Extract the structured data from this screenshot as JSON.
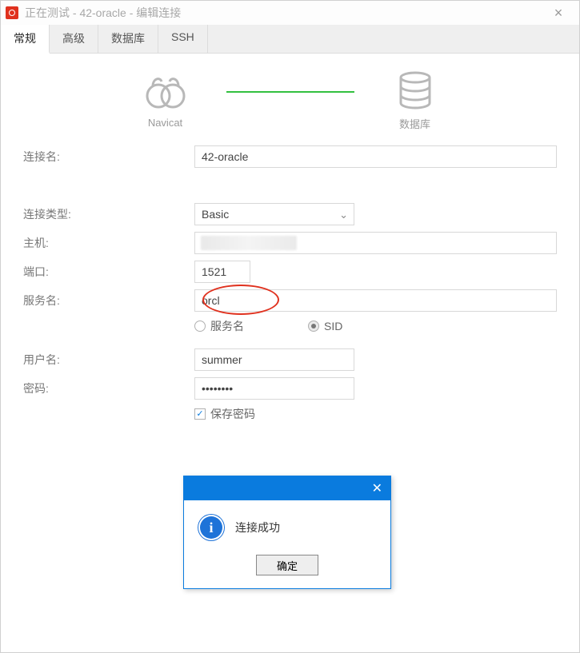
{
  "window_title": "正在测试 - 42-oracle - 编辑连接",
  "tabs": {
    "general": "常规",
    "advanced": "高级",
    "database": "数据库",
    "ssh": "SSH"
  },
  "diagram": {
    "left_label": "Navicat",
    "right_label": "数据库"
  },
  "labels": {
    "conn_name": "连接名:",
    "conn_type": "连接类型:",
    "host": "主机:",
    "port": "端口:",
    "service_name": "服务名:",
    "user": "用户名:",
    "password": "密码:"
  },
  "values": {
    "conn_name": "42-oracle",
    "conn_type": "Basic",
    "host": "",
    "port": "1521",
    "service_name": "orcl",
    "user": "summer",
    "password": "••••••••"
  },
  "radio": {
    "service_name": "服务名",
    "sid": "SID",
    "selected": "sid"
  },
  "checkbox": {
    "save_password": "保存密码",
    "checked": true
  },
  "modal": {
    "message": "连接成功",
    "ok": "确定"
  }
}
